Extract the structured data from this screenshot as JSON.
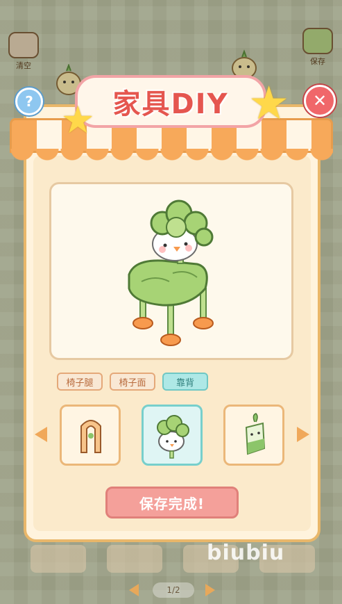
{
  "top_left": {
    "clear_label": "清空"
  },
  "top_right": {
    "save_label": "保存"
  },
  "dialog": {
    "title": "家具DIY",
    "tabs": [
      {
        "label": "椅子腿",
        "selected": false
      },
      {
        "label": "椅子面",
        "selected": false
      },
      {
        "label": "靠背",
        "selected": true
      }
    ],
    "options": [
      {
        "icon": "arch-backrest-icon",
        "selected": false
      },
      {
        "icon": "lettuce-duck-backrest-icon",
        "selected": true
      },
      {
        "icon": "radish-backrest-icon",
        "selected": false
      }
    ],
    "save_button_label": "保存完成!"
  },
  "pager": {
    "text": "1/2"
  },
  "watermark": "biubiu",
  "colors": {
    "accent_orange": "#f7a95a",
    "title_red": "#e5564f",
    "selected_teal": "#77cfcc",
    "save_pink": "#f4a09a"
  }
}
